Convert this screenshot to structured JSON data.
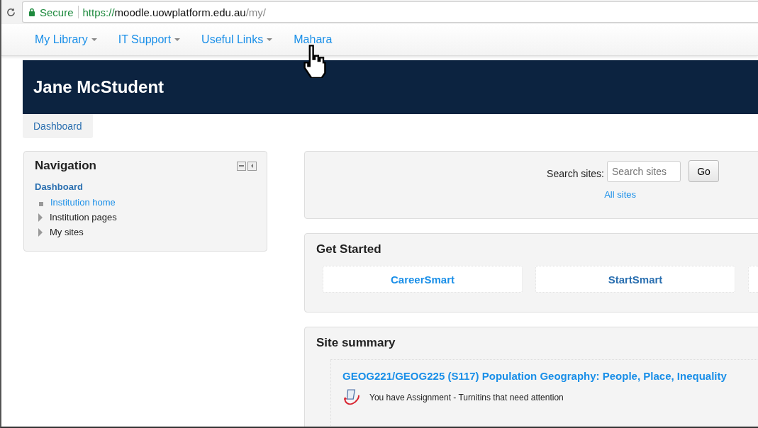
{
  "browser": {
    "secure_label": "Secure",
    "url": [
      {
        "kind": "scheme",
        "text": "https://"
      },
      {
        "kind": "host",
        "text": "moodle.uowplatform.edu.au"
      },
      {
        "kind": "path",
        "text": "/my/"
      }
    ]
  },
  "menu": [
    {
      "label": "My Library",
      "dropdown": true
    },
    {
      "label": "IT Support",
      "dropdown": true
    },
    {
      "label": "Useful Links",
      "dropdown": true
    },
    {
      "label": "Mahara",
      "dropdown": false
    }
  ],
  "banner": {
    "title": "Jane McStudent"
  },
  "breadcrumb": [
    "Dashboard"
  ],
  "navigation": {
    "title": "Navigation",
    "root": "Dashboard",
    "items": [
      {
        "kind": "leaf",
        "label": "Institution home"
      },
      {
        "kind": "branch",
        "label": "Institution pages"
      },
      {
        "kind": "branch",
        "label": "My sites"
      }
    ]
  },
  "search": {
    "label": "Search sites:",
    "placeholder": "Search sites",
    "button": "Go",
    "link": "All sites"
  },
  "get_started": {
    "title": "Get Started",
    "tiles": [
      {
        "label": "CareerSmart",
        "selected": false
      },
      {
        "label": "StartSmart",
        "selected": true
      }
    ]
  },
  "site_summary": {
    "title": "Site summary",
    "course": "GEOG221/GEOG225 (S117) Population Geography: People, Place, Inequality",
    "notice": "You have Assignment - Turnitins that need attention"
  }
}
